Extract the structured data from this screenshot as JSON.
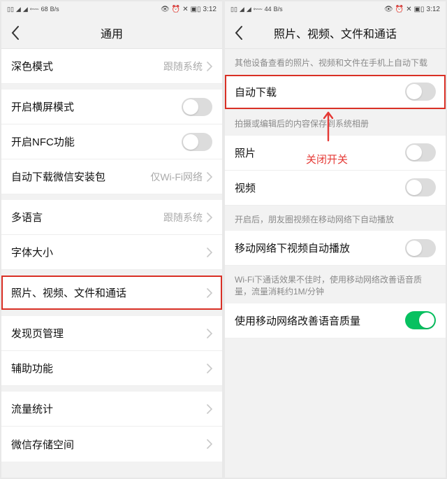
{
  "status": {
    "net_left": "68",
    "net_left_unit": "B/s",
    "net_right": "44",
    "net_right_unit": "B/s",
    "time": "3:12"
  },
  "left": {
    "title": "通用",
    "rows": [
      {
        "label": "深色模式",
        "value": "跟随系统",
        "type": "link"
      },
      {
        "label": "开启横屏模式",
        "type": "toggle",
        "on": false,
        "spacer_before": true
      },
      {
        "label": "开启NFC功能",
        "type": "toggle",
        "on": false
      },
      {
        "label": "自动下载微信安装包",
        "value": "仅Wi-Fi网络",
        "type": "link"
      },
      {
        "label": "多语言",
        "value": "跟随系统",
        "type": "link",
        "spacer_before": true
      },
      {
        "label": "字体大小",
        "type": "link"
      },
      {
        "label": "照片、视频、文件和通话",
        "type": "link",
        "highlight": true,
        "spacer_before": true
      },
      {
        "label": "发现页管理",
        "type": "link",
        "spacer_before": true
      },
      {
        "label": "辅助功能",
        "type": "link"
      },
      {
        "label": "流量统计",
        "type": "link",
        "spacer_before": true
      },
      {
        "label": "微信存储空间",
        "type": "link"
      }
    ]
  },
  "right": {
    "title": "照片、视频、文件和通话",
    "annotation": "关闭开关",
    "sections": [
      {
        "header": "其他设备查看的照片、视频和文件在手机上自动下载",
        "rows": [
          {
            "label": "自动下载",
            "type": "toggle",
            "on": false,
            "highlight": true
          }
        ]
      },
      {
        "header": "拍摄或编辑后的内容保存到系统相册",
        "rows": [
          {
            "label": "照片",
            "type": "toggle",
            "on": false
          },
          {
            "label": "视频",
            "type": "toggle",
            "on": false
          }
        ]
      },
      {
        "header": "开启后，朋友圈视频在移动网络下自动播放",
        "rows": [
          {
            "label": "移动网络下视频自动播放",
            "type": "toggle",
            "on": false
          }
        ]
      },
      {
        "header": "Wi-Fi下通话效果不佳时，使用移动网络改善语音质量，流量消耗约1M/分钟",
        "rows": [
          {
            "label": "使用移动网络改善语音质量",
            "type": "toggle",
            "on": true
          }
        ]
      }
    ]
  }
}
